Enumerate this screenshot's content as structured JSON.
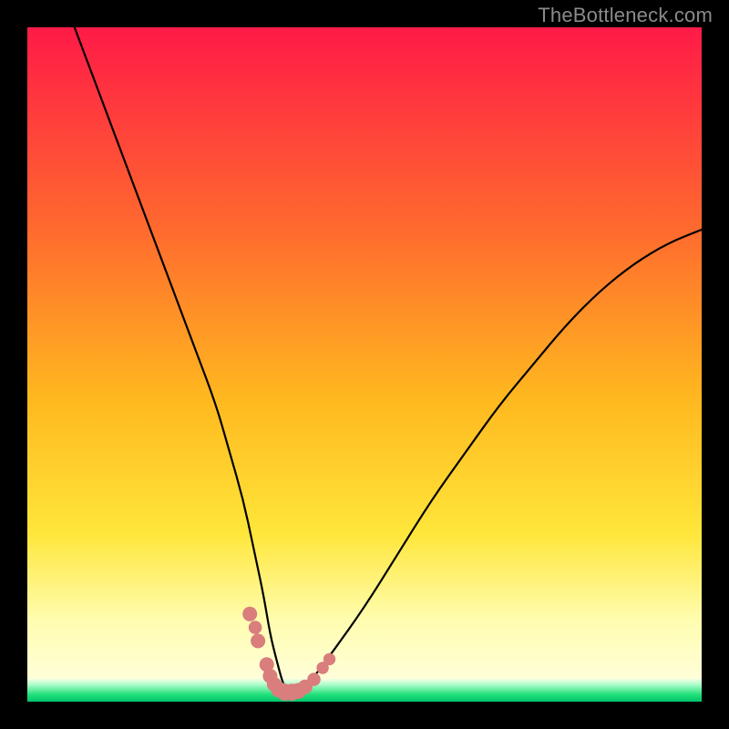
{
  "watermark": {
    "text": "TheBottleneck.com"
  },
  "colors": {
    "black": "#000000",
    "curve": "#000000",
    "marker": "#d97d7d",
    "grad_top": "#ff1a47",
    "grad_mid1": "#ff7a2e",
    "grad_mid2": "#ffd21f",
    "grad_low": "#fff56a",
    "grad_pale": "#ffffe0",
    "green_light": "#b6ffd0",
    "green": "#22e07a",
    "green_deep": "#00c46a"
  },
  "chart_data": {
    "type": "line",
    "title": "",
    "xlabel": "",
    "ylabel": "",
    "xlim": [
      0,
      100
    ],
    "ylim": [
      0,
      100
    ],
    "grid": false,
    "legend": false,
    "series": [
      {
        "name": "bottleneck-curve",
        "x": [
          7,
          10,
          13,
          16,
          19,
          22,
          25,
          28,
          30,
          32,
          33.5,
          35,
          36,
          37,
          37.8,
          38.5,
          40,
          42,
          45,
          50,
          55,
          60,
          65,
          70,
          75,
          80,
          85,
          90,
          95,
          100
        ],
        "y": [
          100,
          92,
          84,
          76,
          68,
          60,
          52,
          44,
          37,
          30,
          23,
          16,
          10,
          6,
          3,
          1.5,
          1.5,
          3,
          7,
          14,
          22,
          30,
          37,
          44,
          50,
          56,
          61,
          65,
          68,
          70
        ]
      }
    ],
    "markers": {
      "name": "bottleneck-optimal-markers",
      "points": [
        {
          "x": 33.0,
          "y": 13.0,
          "r": 1.2
        },
        {
          "x": 33.8,
          "y": 11.0,
          "r": 1.1
        },
        {
          "x": 34.2,
          "y": 9.0,
          "r": 1.2
        },
        {
          "x": 35.5,
          "y": 5.5,
          "r": 1.2
        },
        {
          "x": 36.0,
          "y": 3.8,
          "r": 1.2
        },
        {
          "x": 36.6,
          "y": 2.6,
          "r": 1.2
        },
        {
          "x": 37.3,
          "y": 1.8,
          "r": 1.3
        },
        {
          "x": 38.2,
          "y": 1.4,
          "r": 1.4
        },
        {
          "x": 39.2,
          "y": 1.4,
          "r": 1.4
        },
        {
          "x": 40.2,
          "y": 1.6,
          "r": 1.3
        },
        {
          "x": 41.2,
          "y": 2.2,
          "r": 1.2
        },
        {
          "x": 42.5,
          "y": 3.3,
          "r": 1.1
        },
        {
          "x": 43.8,
          "y": 5.0,
          "r": 1.0
        },
        {
          "x": 44.8,
          "y": 6.3,
          "r": 1.0
        }
      ]
    },
    "background_gradient_stops": [
      {
        "offset": 0,
        "color": "#ff1a47"
      },
      {
        "offset": 30,
        "color": "#ff6a2e"
      },
      {
        "offset": 55,
        "color": "#ffb81f"
      },
      {
        "offset": 75,
        "color": "#ffe63a"
      },
      {
        "offset": 88,
        "color": "#fffdb0"
      },
      {
        "offset": 100,
        "color": "#ffffe8"
      }
    ],
    "green_band": {
      "from_y": 0,
      "to_y": 3.5
    }
  }
}
